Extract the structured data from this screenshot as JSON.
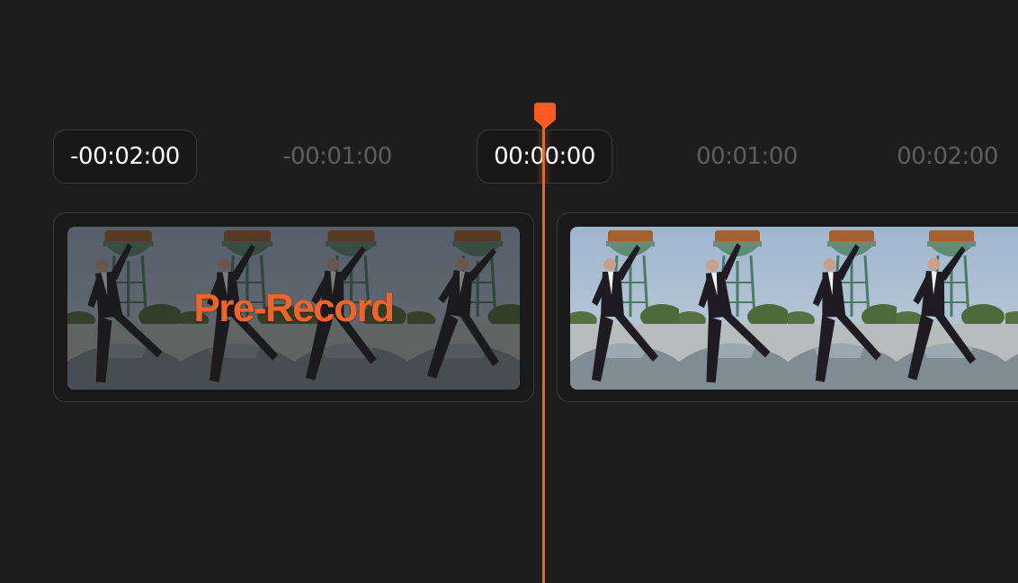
{
  "timeline": {
    "ticks": [
      {
        "label": "-00:02:00",
        "highlighted": true
      },
      {
        "label": "-00:01:00",
        "highlighted": false
      },
      {
        "label": "00:00:00",
        "highlighted": true
      },
      {
        "label": "00:01:00",
        "highlighted": false
      },
      {
        "label": "00:02:00",
        "highlighted": false
      }
    ],
    "playhead_time": "00:00:00"
  },
  "pre_record_clip": {
    "label": "Pre-Record",
    "label_color": "#f0642a",
    "frames": 4,
    "dimmed": true
  },
  "recording_clip": {
    "frames": 5,
    "dimmed": false
  },
  "colors": {
    "background": "#1d1d1d",
    "accent": "#ff5a1f",
    "tick_inactive": "#5e5e5e",
    "tick_active": "#ffffff"
  },
  "icons": {
    "playhead_handle": "playhead-marker-icon"
  }
}
